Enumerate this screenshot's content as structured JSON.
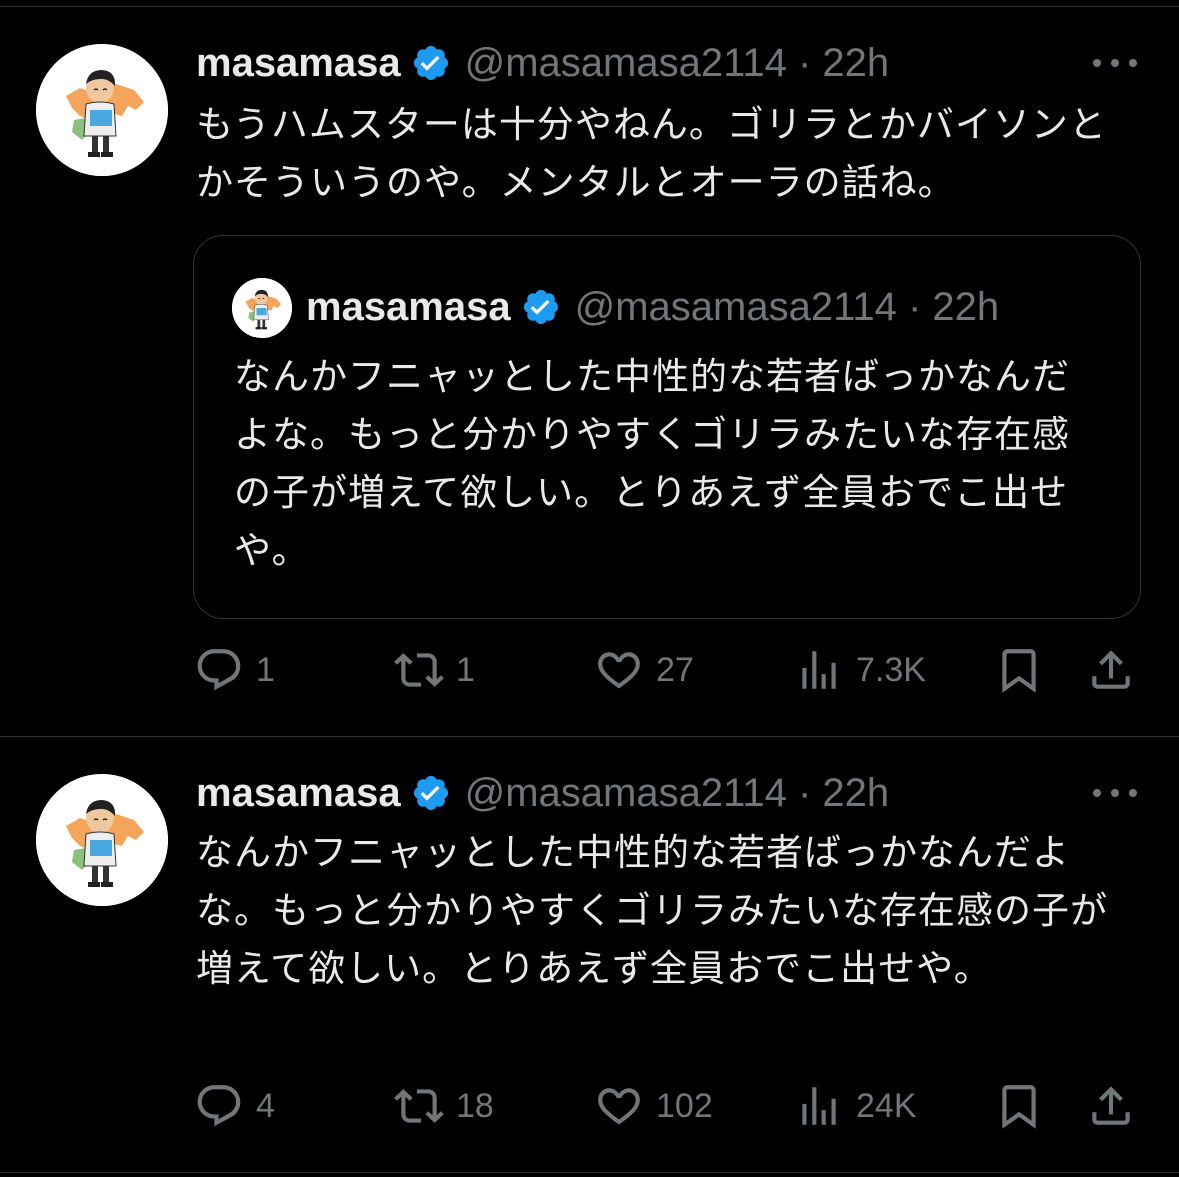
{
  "colors": {
    "background": "#000000",
    "text_primary": "#e7e9ea",
    "text_secondary": "#71767b",
    "verified_blue": "#1d9bf0",
    "border": "#2f3336"
  },
  "tweets": [
    {
      "author_name": "masamasa",
      "verified": true,
      "handle_time": "@masamasa2114 · 22h",
      "text": "もうハムスターは十分やねん。ゴリラとかバイソンとかそういうのや。メンタルとオーラの話ね。",
      "quoted": {
        "author_name": "masamasa",
        "verified": true,
        "handle_time": "@masamasa2114 · 22h",
        "text": "なんかフニャッとした中性的な若者ばっかなんだよな。もっと分かりやすくゴリラみたいな存在感の子が増えて欲しい。とりあえず全員おでこ出せや。"
      },
      "actions": {
        "replies": "1",
        "reposts": "1",
        "likes": "27",
        "views": "7.3K"
      },
      "icons": [
        "reply-icon",
        "repost-icon",
        "like-icon",
        "views-icon",
        "bookmark-icon",
        "share-icon"
      ]
    },
    {
      "author_name": "masamasa",
      "verified": true,
      "handle_time": "@masamasa2114 · 22h",
      "text": "なんかフニャッとした中性的な若者ばっかなんだよな。もっと分かりやすくゴリラみたいな存在感の子が増えて欲しい。とりあえず全員おでこ出せや。",
      "actions": {
        "replies": "4",
        "reposts": "18",
        "likes": "102",
        "views": "24K"
      },
      "icons": [
        "reply-icon",
        "repost-icon",
        "like-icon",
        "views-icon",
        "bookmark-icon",
        "share-icon"
      ]
    }
  ]
}
